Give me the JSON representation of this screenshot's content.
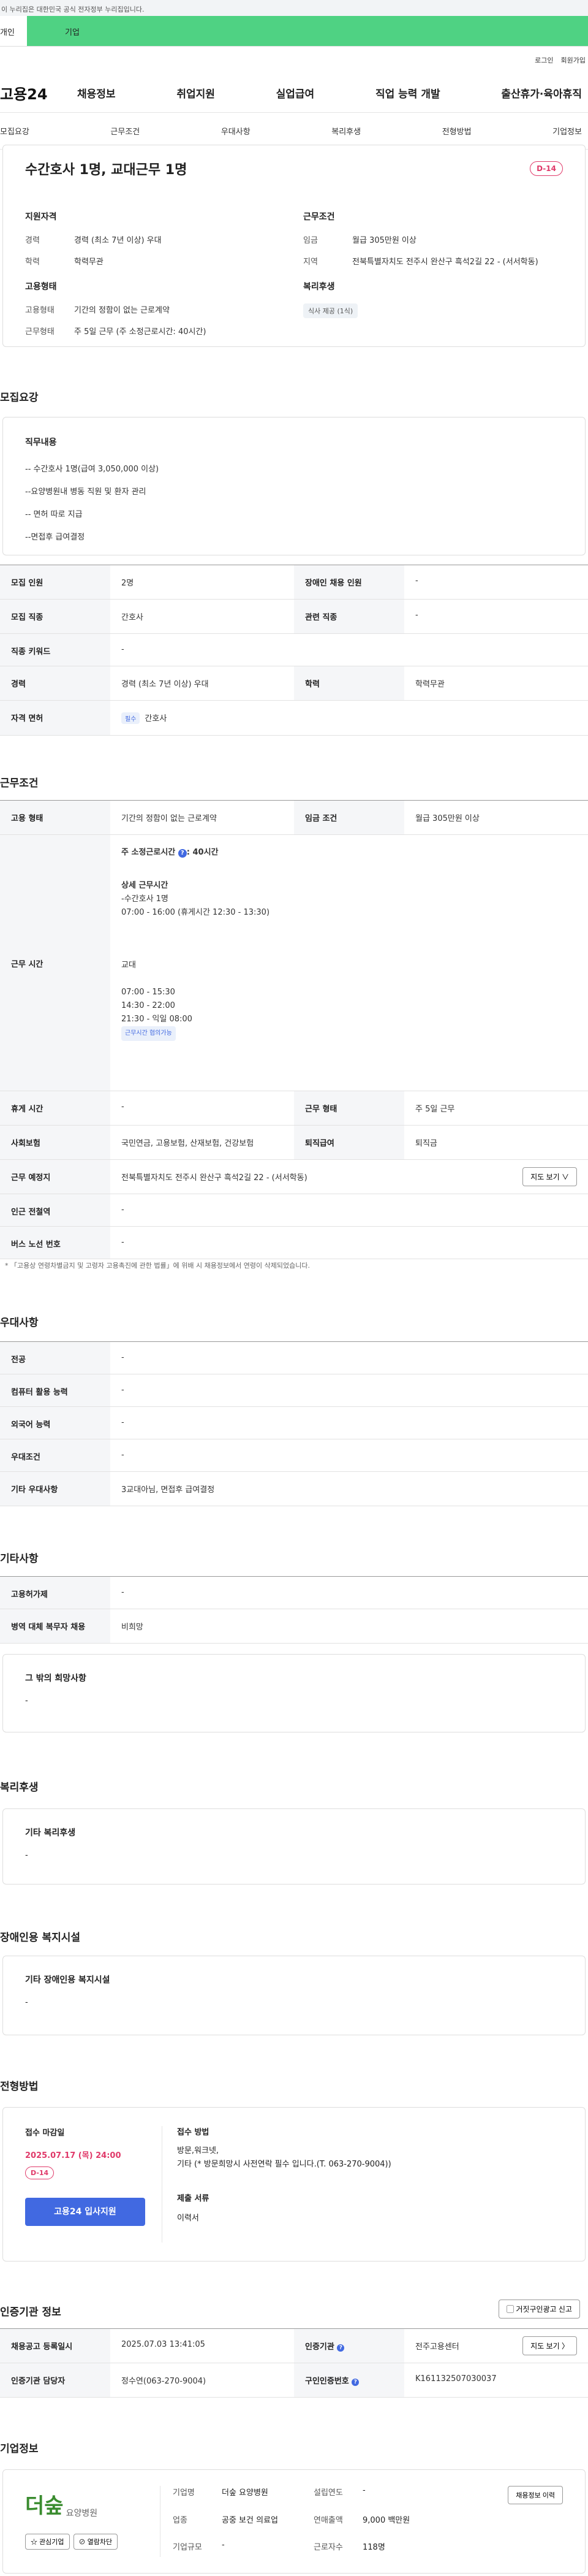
{
  "banner": {
    "text": "이 누리집은 대한민국 공식 전자정부 누리집입니다."
  },
  "topTabs": [
    "개인",
    "기업"
  ],
  "util": [
    "로그인",
    "회원가입"
  ],
  "logo": "고용24",
  "gnb": [
    "채용정보",
    "취업지원",
    "실업급여",
    "직업 능력 개발",
    "출산휴가·육아휴직"
  ],
  "subtabs": [
    "모집요강",
    "근무조건",
    "우대사항",
    "복리후생",
    "전형방법",
    "기업정보"
  ],
  "summary": {
    "title": "수간호사 1명, 교대근무 1명",
    "dday": "D-14",
    "qual": {
      "title": "지원자격",
      "career_k": "경력",
      "career_v": "경력 (최소 7년 이상) 우대",
      "edu_k": "학력",
      "edu_v": "학력무관"
    },
    "work": {
      "title": "근무조건",
      "wage_k": "임금",
      "wage_v": "월급 305만원 이상",
      "region_k": "지역",
      "region_v": "전북특별자치도 전주시 완산구 흑석2길 22 - (서서학동)"
    },
    "emp": {
      "title": "고용형태",
      "type_k": "고용형태",
      "type_v": "기간의 정함이 없는 근로계약",
      "hours_k": "근무형태",
      "hours_v": "주 5일 근무 (주 소정근로시간: 40시간)"
    },
    "welfare": {
      "title": "복리후생",
      "tag": "식사 제공 (1식)"
    }
  },
  "recruit": {
    "title": "모집요강",
    "duty_title": "직무내용",
    "duties": [
      "-- 수간호사 1명(급여 3,050,000 이상)",
      "--요양병원내 병동 직원 및 환자 관리",
      "-- 면허 따로 지급",
      "--면접후 급여결정"
    ],
    "count_k": "모집 인원",
    "count_v": "2명",
    "disab_k": "장애인 채용 인원",
    "disab_v": "-",
    "job_k": "모집 직종",
    "job_v": "간호사",
    "rel_k": "관련 직종",
    "rel_v": "-",
    "kw_k": "직종 키워드",
    "kw_v": "-",
    "career_k": "경력",
    "career_v": "경력 (최소 7년 이상) 우대",
    "edu_k": "학력",
    "edu_v": "학력무관",
    "lic_k": "자격 면허",
    "lic_tag": "필수",
    "lic_v": "간호사"
  },
  "cond": {
    "title": "근무조건",
    "type_k": "고용 형태",
    "type_v": "기간의 정함이 없는 근로계약",
    "wage_k": "임금 조건",
    "wage_v": "월급 305만원 이상",
    "time_k": "근무 시간",
    "weekly": "주 소정근로시간",
    "weekly_v": ": 40시간",
    "detail_title": "상세 근무시간",
    "detail_lines": [
      "-수간호사 1명",
      "07:00 - 16:00 (휴게시간 12:30 - 13:30)"
    ],
    "shift_title": "교대",
    "shift_lines": [
      "07:00 - 15:30",
      "14:30 - 22:00",
      "21:30 - 익일 08:00"
    ],
    "shift_tag": "근무시간 협의가능",
    "rest_k": "휴게 시간",
    "rest_v": "-",
    "form_k": "근무 형태",
    "form_v": "주 5일 근무",
    "ins_k": "사회보험",
    "ins_v": "국민연금, 고용보험, 산재보험, 건강보험",
    "sev_k": "퇴직급여",
    "sev_v": "퇴직금",
    "place_k": "근무 예정지",
    "place_v": "전북특별자치도 전주시 완산구 흑석2길 22 - (서서학동)",
    "map_btn": "지도 보기 ∨",
    "sub_k": "인근 전철역",
    "sub_v": "-",
    "bus_k": "버스 노선 번호",
    "bus_v": "-",
    "note": "* 「고용상 연령차별금지 및 고령자 고용촉진에 관한 법률」에 위배 시 채용정보에서 연령이 삭제되었습니다."
  },
  "pref": {
    "title": "우대사항",
    "rows": [
      [
        "전공",
        "-"
      ],
      [
        "컴퓨터 활용 능력",
        "-"
      ],
      [
        "외국어 능력",
        "-"
      ],
      [
        "우대조건",
        "-"
      ],
      [
        "기타 우대사항",
        "3교대아님, 면접후 급여결정"
      ]
    ]
  },
  "etc": {
    "title": "기타사항",
    "rows": [
      [
        "고용허가제",
        "-"
      ],
      [
        "병역 대체 복무자 채용",
        "비희망"
      ]
    ],
    "other_title": "그 밖의 희망사항",
    "other_v": "-"
  },
  "welfare": {
    "title": "복리후생",
    "box_title": "기타 복리후생",
    "box_v": "-"
  },
  "disab": {
    "title": "장애인용 복지시설",
    "box_title": "기타 장애인용 복지시설",
    "box_v": "-"
  },
  "process": {
    "title": "전형방법",
    "deadline_title": "접수 마감일",
    "deadline": "2025.07.17 (목) 24:00",
    "dday": "D-14",
    "apply_btn": "고용24 입사지원",
    "method_title": "접수 방법",
    "method_lines": [
      "방문,워크넷,",
      "기타 (* 방문희망시 사전연락 필수 입니다.(T. 063-270-9004))"
    ],
    "doc_title": "제출 서류",
    "doc_v": "이력서"
  },
  "cert": {
    "title": "인증기관 정보",
    "report_btn": "거짓구인광고 신고",
    "reg_k": "채용공고 등록일시",
    "reg_v": "2025.07.03 13:41:05",
    "org_k": "인증기관",
    "org_v": "전주고용센터",
    "map_btn": "지도 보기 〉",
    "mgr_k": "인증기관 담당자",
    "mgr_v": "정수연(063-270-9004)",
    "id_k": "구인인증번호",
    "id_v": "K161132507030037"
  },
  "company": {
    "title": "기업정보",
    "logo_text": "더숲",
    "logo_sub": "요양병원",
    "fav_btn": "관심기업",
    "block_btn": "열람차단",
    "hire_btn": "채용정보 이력",
    "name_k": "기업명",
    "name_v": "더숲 요양병원",
    "year_k": "설립연도",
    "year_v": "-",
    "ind_k": "업종",
    "ind_v": "공중 보건 의료업",
    "sales_k": "연매출액",
    "sales_v": "9,000 백만원",
    "size_k": "기업규모",
    "size_v": "-",
    "emp_k": "근로자수",
    "emp_v": "118명"
  }
}
